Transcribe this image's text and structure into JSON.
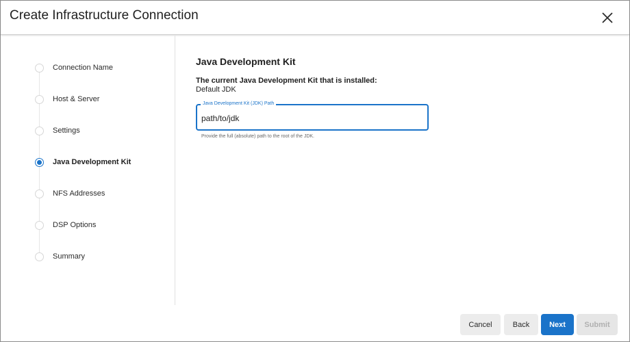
{
  "dialog": {
    "title": "Create Infrastructure Connection"
  },
  "steps": [
    {
      "label": "Connection Name",
      "active": false
    },
    {
      "label": "Host & Server",
      "active": false
    },
    {
      "label": "Settings",
      "active": false
    },
    {
      "label": "Java Development Kit",
      "active": true
    },
    {
      "label": "NFS Addresses",
      "active": false
    },
    {
      "label": "DSP Options",
      "active": false
    },
    {
      "label": "Summary",
      "active": false
    }
  ],
  "main": {
    "section_title": "Java Development Kit",
    "current_label": "The current Java Development Kit that is installed:",
    "current_value": "Default JDK",
    "jdk_field": {
      "label": "Java Development Kit (JDK) Path",
      "value": "path/to/jdk",
      "helper": "Provide the full (absolute) path to the root of the JDK."
    }
  },
  "footer": {
    "cancel": "Cancel",
    "back": "Back",
    "next": "Next",
    "submit": "Submit"
  },
  "colors": {
    "accent": "#1a73c9",
    "disabled": "#e6e6e6"
  },
  "icons": {
    "close": "close-icon"
  }
}
